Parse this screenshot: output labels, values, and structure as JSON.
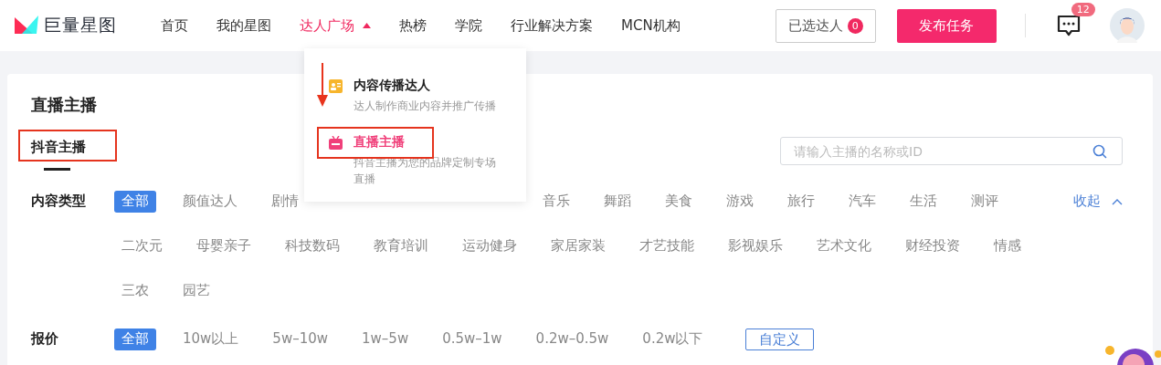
{
  "header": {
    "logo": "巨量星图",
    "nav": [
      {
        "label": "首页",
        "selected": false
      },
      {
        "label": "我的星图",
        "selected": false
      },
      {
        "label": "达人广场",
        "selected": true,
        "expanded": true
      },
      {
        "label": "热榜",
        "selected": false
      },
      {
        "label": "学院",
        "selected": false
      },
      {
        "label": "行业解决方案",
        "selected": false
      },
      {
        "label": "MCN机构",
        "selected": false
      }
    ],
    "selected_button": {
      "label": "已选达人",
      "count": "0"
    },
    "publish_button": "发布任务",
    "messages_badge": "12"
  },
  "dropdown": [
    {
      "kind": "content",
      "title": "内容传播达人",
      "description": "达人制作商业内容并推广传播",
      "selected": false
    },
    {
      "kind": "live",
      "title": "直播主播",
      "description": "抖音主播为您的品牌定制专场直播",
      "selected": true
    }
  ],
  "page": {
    "title": "直播主播",
    "tabs": [
      {
        "label": "抖音主播",
        "selected": true
      }
    ],
    "search": {
      "placeholder": "请输入主播的名称或ID"
    },
    "filters": [
      {
        "label": "内容类型",
        "collapse": "收起",
        "options": [
          {
            "text": "全部",
            "selected": true
          },
          {
            "text": "颜值达人",
            "selected": false
          },
          {
            "text": "剧情",
            "selected": false
          },
          {
            "text": "音乐",
            "selected": false
          },
          {
            "text": "舞蹈",
            "selected": false
          },
          {
            "text": "美食",
            "selected": false
          },
          {
            "text": "游戏",
            "selected": false
          },
          {
            "text": "旅行",
            "selected": false
          },
          {
            "text": "汽车",
            "selected": false
          },
          {
            "text": "生活",
            "selected": false
          },
          {
            "text": "测评",
            "selected": false
          },
          {
            "text": "二次元",
            "selected": false
          },
          {
            "text": "母婴亲子",
            "selected": false
          },
          {
            "text": "科技数码",
            "selected": false
          },
          {
            "text": "教育培训",
            "selected": false
          },
          {
            "text": "运动健身",
            "selected": false
          },
          {
            "text": "家居家装",
            "selected": false
          },
          {
            "text": "才艺技能",
            "selected": false
          },
          {
            "text": "影视娱乐",
            "selected": false
          },
          {
            "text": "艺术文化",
            "selected": false
          },
          {
            "text": "财经投资",
            "selected": false
          },
          {
            "text": "情感",
            "selected": false
          },
          {
            "text": "三农",
            "selected": false
          },
          {
            "text": "园艺",
            "selected": false
          }
        ]
      },
      {
        "label": "报价",
        "custom": "自定义",
        "options": [
          {
            "text": "全部",
            "selected": true
          },
          {
            "text": "10w以上",
            "selected": false
          },
          {
            "text": "5w–10w",
            "selected": false
          },
          {
            "text": "1w–5w",
            "selected": false
          },
          {
            "text": "0.5w–1w",
            "selected": false
          },
          {
            "text": "0.2w–0.5w",
            "selected": false
          },
          {
            "text": "0.2w以下",
            "selected": false
          }
        ]
      }
    ]
  }
}
